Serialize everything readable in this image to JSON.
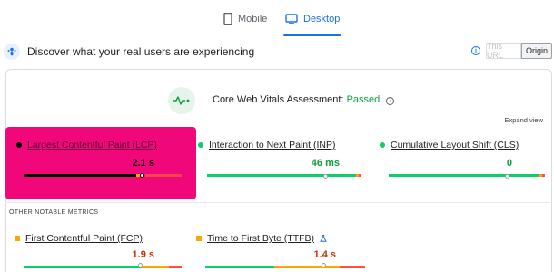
{
  "tabs": [
    {
      "label": "Mobile",
      "icon": "phone-icon",
      "active": false
    },
    {
      "label": "Desktop",
      "icon": "monitor-icon",
      "active": true
    }
  ],
  "discover": {
    "title": "Discover what your real users are experiencing",
    "toggle": {
      "this_url": "This URL",
      "origin": "Origin",
      "selected": "Origin"
    }
  },
  "assessment": {
    "label": "Core Web Vitals Assessment:",
    "status": "Passed",
    "expand": "Expand view"
  },
  "core_metrics": [
    {
      "name": "Largest Contentful Paint (LCP)",
      "value": "2.1 s",
      "status_color": "#000000",
      "value_color": "#000000",
      "marker_fraction": 0.78
    },
    {
      "name": "Interaction to Next Paint (INP)",
      "value": "46 ms",
      "status_color": "#0cce6b",
      "value_color": "#0d9e3e",
      "marker_fraction": 0.78
    },
    {
      "name": "Cumulative Layout Shift (CLS)",
      "value": "0",
      "status_color": "#0cce6b",
      "value_color": "#0d9e3e",
      "marker_fraction": 0.78
    }
  ],
  "other_section_label": "OTHER NOTABLE METRICS",
  "other_metrics": [
    {
      "name": "First Contentful Paint (FCP)",
      "value": "1.9 s",
      "status_color": "#ffa400",
      "value_color": "#c33300",
      "marker_fraction": 0.78
    },
    {
      "name": "Time to First Byte (TTFB)",
      "value": "1.4 s",
      "status_color": "#ffa400",
      "value_color": "#c33300",
      "marker_fraction": 0.78,
      "experimental_icon": "flask-icon"
    }
  ],
  "colors": {
    "good": "#0cce6b",
    "average": "#ffa400",
    "poor": "#ff4e42",
    "accent": "#1a73e8",
    "highlight": "#f0087a"
  }
}
